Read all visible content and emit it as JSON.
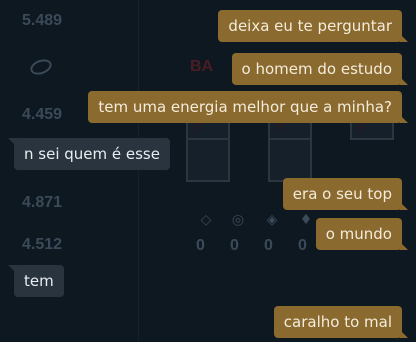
{
  "background": {
    "scores": [
      "5.489",
      "4.459",
      "4.871",
      "4.512"
    ],
    "label": "BA",
    "zeros": [
      "0",
      "0",
      "0",
      "0",
      "0",
      "2"
    ]
  },
  "messages": [
    {
      "from": "me",
      "text": "deixa eu te perguntar"
    },
    {
      "from": "me",
      "text": "o homem do estudo"
    },
    {
      "from": "me",
      "text": "tem uma energia melhor que a minha?"
    },
    {
      "from": "them",
      "text": "n sei quem é esse"
    },
    {
      "from": "me",
      "text": "era o seu top"
    },
    {
      "from": "me",
      "text": "o mundo"
    },
    {
      "from": "them",
      "text": "tem"
    },
    {
      "from": "me",
      "text": "caralho to mal"
    }
  ],
  "colors": {
    "background": "#0e1821",
    "my_bubble": "#8a6a2e",
    "their_bubble": "#2a343e"
  }
}
